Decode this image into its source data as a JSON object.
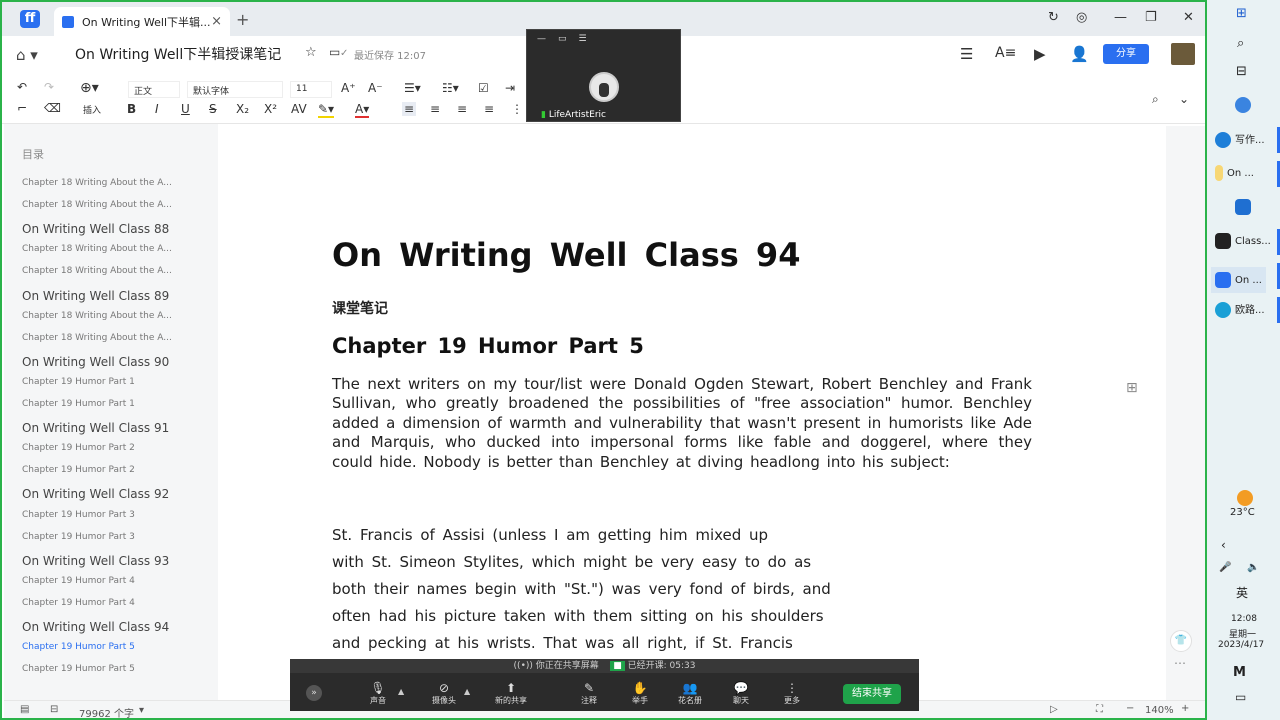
{
  "tabbar": {
    "logo": "ff",
    "tab_title": "On Writing Well下半辑...",
    "tab_close": "×",
    "new_tab": "+",
    "controls": [
      "↻",
      "◎",
      "—",
      "❐",
      "✕"
    ]
  },
  "header": {
    "doc_title": "On Writing Well下半辑授课笔记",
    "save_status": "最近保存 12:07",
    "share": "分享"
  },
  "toolbar": {
    "insert_label": "插入",
    "style_select": "正文",
    "font_select": "默认字体",
    "size_select": "11"
  },
  "float_video": {
    "name": "LifeArtistEric"
  },
  "sidebar": {
    "heading": "目录",
    "items": [
      {
        "label": "Chapter 18 Writing About the A...",
        "level": 2
      },
      {
        "label": "Chapter 18 Writing About the A...",
        "level": 2
      },
      {
        "label": "On Writing Well Class 88",
        "level": 1
      },
      {
        "label": "Chapter 18 Writing About the A...",
        "level": 2
      },
      {
        "label": "Chapter 18 Writing About the A...",
        "level": 2
      },
      {
        "label": "On Writing Well Class 89",
        "level": 1
      },
      {
        "label": "Chapter 18 Writing About the A...",
        "level": 2
      },
      {
        "label": "Chapter 18 Writing About the A...",
        "level": 2
      },
      {
        "label": "On Writing Well Class 90",
        "level": 1
      },
      {
        "label": "Chapter 19 Humor Part 1",
        "level": 2
      },
      {
        "label": "Chapter 19 Humor Part 1",
        "level": 2
      },
      {
        "label": "On Writing Well Class 91",
        "level": 1
      },
      {
        "label": "Chapter 19 Humor Part 2",
        "level": 2
      },
      {
        "label": "Chapter 19 Humor Part 2",
        "level": 2
      },
      {
        "label": "On Writing Well Class 92",
        "level": 1
      },
      {
        "label": "Chapter 19 Humor Part 3",
        "level": 2
      },
      {
        "label": "Chapter 19 Humor Part 3",
        "level": 2
      },
      {
        "label": "On Writing Well Class 93",
        "level": 1
      },
      {
        "label": "Chapter 19 Humor Part 4",
        "level": 2
      },
      {
        "label": "Chapter 19 Humor Part 4",
        "level": 2
      },
      {
        "label": "On Writing Well Class 94",
        "level": 1
      },
      {
        "label": "Chapter 19 Humor Part 5",
        "level": 2,
        "active": true
      },
      {
        "label": "Chapter 19 Humor Part 5",
        "level": 2
      }
    ]
  },
  "document": {
    "title": "On Writing Well Class 94",
    "subtitle": "课堂笔记",
    "chapter": "Chapter 19 Humor Part 5",
    "paragraph": "The next writers on my tour/list were Donald Ogden Stewart, Robert Benchley and Frank Sullivan, who greatly broadened the possibilities of \"free association\" humor. Benchley added a dimension of warmth and vulnerability that wasn't present in humorists like Ade and Marquis, who ducked into impersonal forms like fable and doggerel, where they could hide. Nobody is better than Benchley at diving headlong into his subject:",
    "quote_lines": [
      "St. Francis of Assisi (unless I am getting him mixed up",
      "with St. Simeon Stylites, which might be very easy to do as",
      "both their names begin with \"St.\") was very fond of birds, and",
      "often had his picture taken with them sitting on his shoulders",
      "and pecking at his wrists. That was all right, if St. Francis"
    ]
  },
  "meeting": {
    "status": "((•)) 你正在共享屏幕",
    "timer": "已经开课: 05:33",
    "buttons": [
      "声音",
      "摄像头",
      "新的共享",
      "注释",
      "举手",
      "花名册",
      "聊天",
      "更多"
    ],
    "end": "结束共享"
  },
  "statusbar": {
    "word_count": "79962 个字",
    "zoom": "140%"
  },
  "taskbar": {
    "items": [
      "写作...",
      "On ...",
      "Class...",
      "On ...",
      "欧路..."
    ],
    "weather": "23°C",
    "ime": "英",
    "time": "12:08",
    "weekday": "星期一",
    "date": "2023/4/17"
  }
}
